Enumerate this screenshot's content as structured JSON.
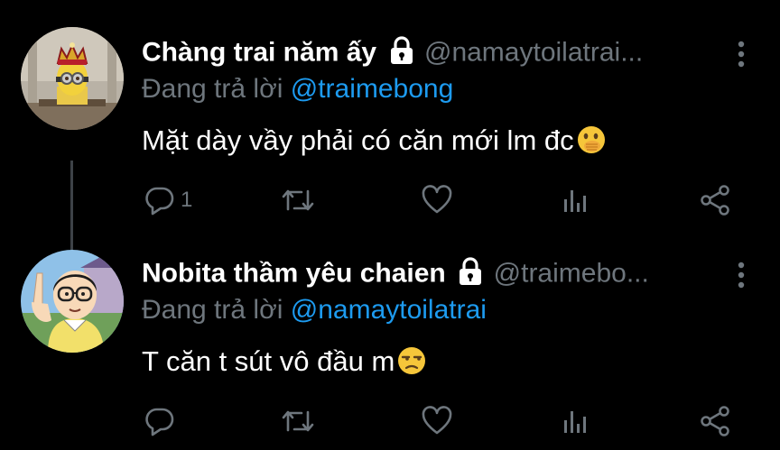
{
  "colors": {
    "background": "#000000",
    "text": "#ffffff",
    "secondary": "#6e767d",
    "mention": "#1d9bf0",
    "thread_line": "#3d4247"
  },
  "tweets": [
    {
      "author_name": "Chàng trai năm ấy",
      "handle": "@namaytoilatrai...",
      "reply_prefix": "Đang trả lời",
      "reply_to": "@traimebong",
      "text": "Mặt dày vầy phải có căn mới lm đc",
      "emoji": "face-with-hand-over-mouth",
      "reply_count": "1",
      "avatar": "minion-king-avatar",
      "locked": true
    },
    {
      "author_name": "Nobita thầm yêu chaien",
      "handle": "@traimebo...",
      "reply_prefix": "Đang trả lời",
      "reply_to": "@namaytoilatrai",
      "text": "T căn t sút vô đầu m",
      "emoji": "unamused-face",
      "reply_count": "",
      "avatar": "nobita-avatar",
      "locked": true
    }
  ],
  "icons": [
    "lock-icon",
    "more-icon",
    "reply-icon",
    "retweet-icon",
    "like-icon",
    "analytics-icon",
    "share-icon"
  ]
}
